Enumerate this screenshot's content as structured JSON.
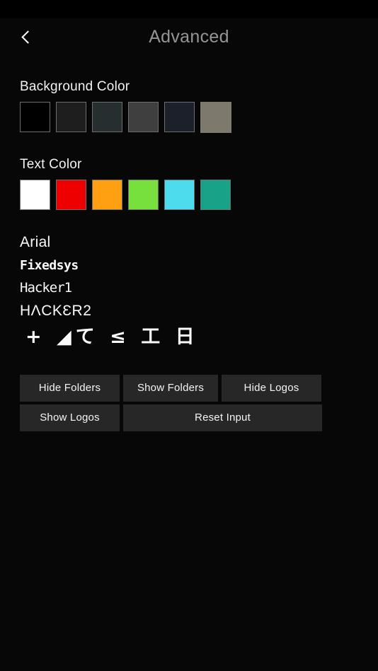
{
  "statusbar": {
    "height_note": ""
  },
  "header": {
    "title": "Advanced",
    "back_icon": "chevron-left-icon"
  },
  "background_color_section": {
    "label": "Background Color",
    "swatches": [
      {
        "name": "black",
        "hex": "#000000",
        "bordered": true
      },
      {
        "name": "dark-gray",
        "hex": "#1e1e1e",
        "bordered": true
      },
      {
        "name": "dark-slate",
        "hex": "#262e30",
        "bordered": true
      },
      {
        "name": "medium-gray",
        "hex": "#3f3f3f",
        "bordered": true
      },
      {
        "name": "navy-black",
        "hex": "#1b202a",
        "bordered": true
      },
      {
        "name": "khaki",
        "hex": "#7d7a6d",
        "bordered": false
      }
    ]
  },
  "text_color_section": {
    "label": "Text Color",
    "swatches": [
      {
        "name": "white",
        "hex": "#ffffff",
        "bordered": true
      },
      {
        "name": "red",
        "hex": "#ef0000",
        "bordered": true
      },
      {
        "name": "orange",
        "hex": "#ffa012",
        "bordered": true
      },
      {
        "name": "green",
        "hex": "#78e03c",
        "bordered": true
      },
      {
        "name": "cyan",
        "hex": "#4ddced",
        "bordered": true
      },
      {
        "name": "teal",
        "hex": "#16a387",
        "bordered": true
      }
    ]
  },
  "font_section": {
    "samples": [
      {
        "name": "arial",
        "text": "Arial"
      },
      {
        "name": "fixedsys",
        "text": "Fixedsys"
      },
      {
        "name": "hacker1",
        "text": "Hacker1"
      },
      {
        "name": "hacker2",
        "text": "HΛCKƐR2"
      },
      {
        "name": "hacker3",
        "text": "+ ◢て ≤ 工 日"
      }
    ]
  },
  "buttons": {
    "hide_folders": "Hide Folders",
    "show_folders": "Show Folders",
    "hide_logos": "Hide Logos",
    "show_logos": "Show Logos",
    "reset_input": "Reset Input"
  }
}
